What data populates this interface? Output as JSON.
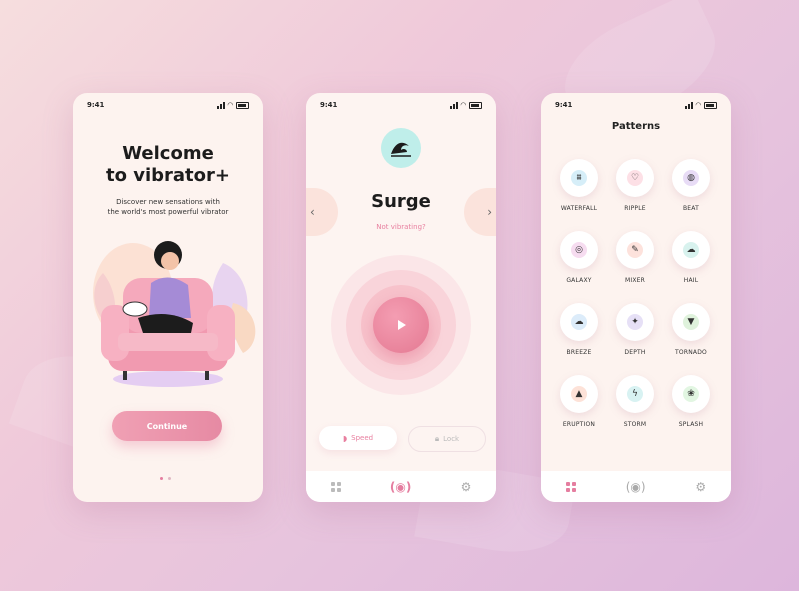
{
  "status_time": "9:41",
  "welcome": {
    "title_line1": "Welcome",
    "title_line2": "to vibrator+",
    "subtitle_line1": "Discover new sensations with",
    "subtitle_line2": "the world's most powerful vibrator",
    "continue_label": "Continue"
  },
  "player": {
    "title": "Surge",
    "status": "Not vibrating?",
    "speed_label": "Speed",
    "lock_label": "Lock",
    "prev_icon": "‹",
    "next_icon": "›"
  },
  "patterns": {
    "title": "Patterns",
    "items": [
      {
        "label": "WATERFALL",
        "icon": "waterfall-icon",
        "tint": "#d6eef8",
        "glyph": "⩩"
      },
      {
        "label": "RIPPLE",
        "icon": "ripple-icon",
        "tint": "#fde0e6",
        "glyph": "♡"
      },
      {
        "label": "BEAT",
        "icon": "beat-icon",
        "tint": "#e8dcf6",
        "glyph": "◍"
      },
      {
        "label": "GALAXY",
        "icon": "galaxy-icon",
        "tint": "#f6dcf0",
        "glyph": "◎"
      },
      {
        "label": "MIXER",
        "icon": "mixer-icon",
        "tint": "#fde2dc",
        "glyph": "✎"
      },
      {
        "label": "HAIL",
        "icon": "hail-icon",
        "tint": "#d8f2ee",
        "glyph": "☁"
      },
      {
        "label": "BREEZE",
        "icon": "breeze-icon",
        "tint": "#dcecfa",
        "glyph": "☁"
      },
      {
        "label": "DEPTH",
        "icon": "depth-icon",
        "tint": "#e6e0f6",
        "glyph": "✦"
      },
      {
        "label": "TORNADO",
        "icon": "tornado-icon",
        "tint": "#dff2dc",
        "glyph": "▼"
      },
      {
        "label": "ERUPTION",
        "icon": "eruption-icon",
        "tint": "#fde2d8",
        "glyph": "▲"
      },
      {
        "label": "STORM",
        "icon": "storm-icon",
        "tint": "#d8f2f2",
        "glyph": "ϟ"
      },
      {
        "label": "SPLASH",
        "icon": "splash-icon",
        "tint": "#e2f6e2",
        "glyph": "❀"
      }
    ]
  },
  "colors": {
    "accent": "#e57ea0",
    "play": "#e47992",
    "wave_badge": "#bfeeea"
  }
}
